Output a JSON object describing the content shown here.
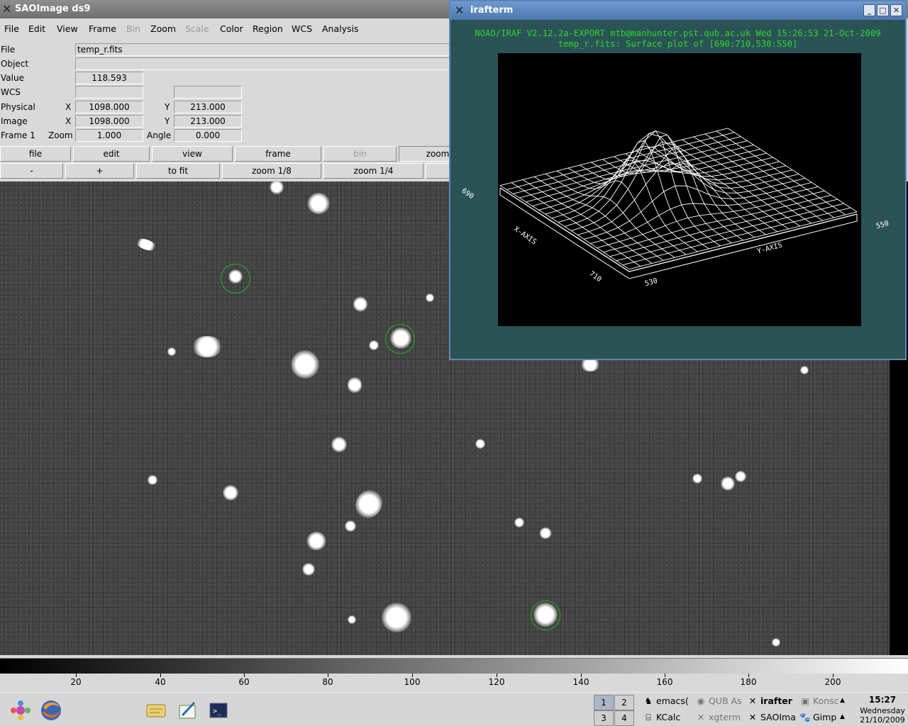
{
  "ds9": {
    "title": "SAOImage ds9",
    "menu": [
      "File",
      "Edit",
      "View",
      "Frame",
      "Bin",
      "Zoom",
      "Scale",
      "Color",
      "Region",
      "WCS",
      "Analysis"
    ],
    "info": {
      "file_label": "File",
      "file_value": "temp_r.fits",
      "object_label": "Object",
      "object_value": "",
      "value_label": "Value",
      "value_value": "118.593",
      "wcs_label": "WCS",
      "physical_label": "Physical",
      "physical_x_label": "X",
      "physical_x": "1098.000",
      "physical_y_label": "Y",
      "physical_y": "213.000",
      "image_label": "Image",
      "image_x_label": "X",
      "image_x": "1098.000",
      "image_y_label": "Y",
      "image_y": "213.000",
      "frame_label": "Frame 1",
      "zoom_label": "Zoom",
      "zoom_value": "1.000",
      "angle_label": "Angle",
      "angle_value": "0.000"
    },
    "buttons_row1": [
      "file",
      "edit",
      "view",
      "frame",
      "bin",
      "zoom"
    ],
    "buttons_row2": [
      "-",
      "+",
      "to fit",
      "zoom 1/8",
      "zoom 1/4"
    ],
    "colorbar_ticks": [
      "20",
      "40",
      "60",
      "80",
      "100",
      "120",
      "140",
      "160",
      "180",
      "200"
    ]
  },
  "irafterm": {
    "title": "irafterm",
    "header_line1": "NOAO/IRAF V2.12.2a-EXPORT mtb@manhunter.pst.qub.ac.uk Wed 15:26:53 21-Oct-2009",
    "header_line2": "temp_r.fits: Surface plot of [690:710,530:550]",
    "axis": {
      "x_axis": "X-AXIS",
      "y_axis": "Y-AXIS",
      "label_690": "690",
      "label_710": "710",
      "label_530": "530",
      "label_550": "550"
    },
    "window_buttons": [
      "_",
      "□",
      "✕"
    ]
  },
  "taskbar": {
    "pager": [
      "1",
      "2",
      "3",
      "4"
    ],
    "tasks": [
      {
        "label": "emacs(",
        "icon": "gnu-icon",
        "state": "normal"
      },
      {
        "label": "QUB As",
        "icon": "browser-icon",
        "state": "muted"
      },
      {
        "label": "irafter",
        "icon": "x-icon",
        "state": "active"
      },
      {
        "label": "Konsc",
        "icon": "konsole-icon",
        "state": "muted"
      },
      {
        "label": "KCalc",
        "icon": "calc-icon",
        "state": "normal"
      },
      {
        "label": "xgterm",
        "icon": "x-icon",
        "state": "muted"
      },
      {
        "label": "SAOIma",
        "icon": "x-icon",
        "state": "normal"
      },
      {
        "label": "Gimp",
        "icon": "gimp-icon",
        "state": "normal"
      }
    ],
    "clock_time": "15:27",
    "clock_day": "Wednesday",
    "clock_date": "21/10/2009"
  }
}
